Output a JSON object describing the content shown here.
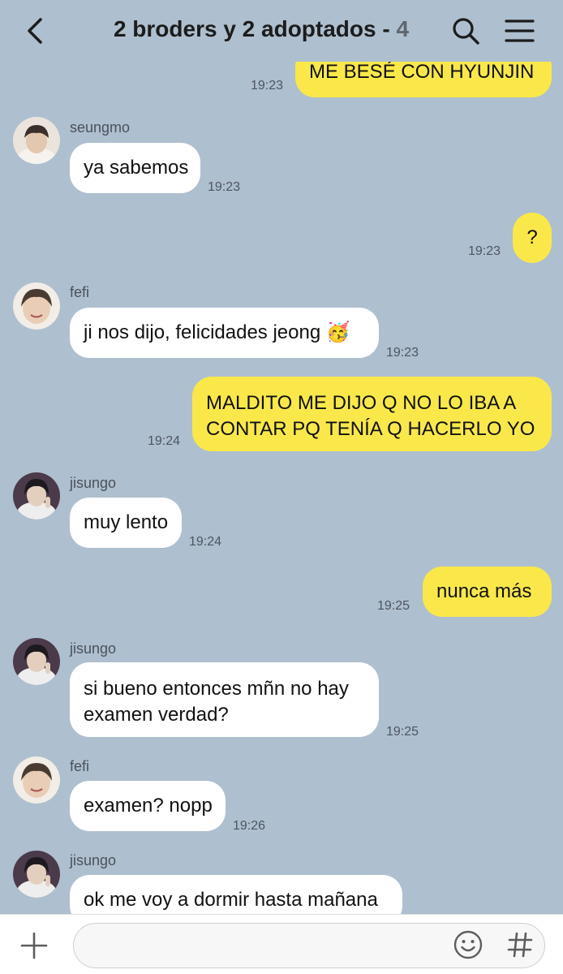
{
  "header": {
    "title": "2 broders y 2 adoptados",
    "member_count": "4",
    "dash": " - "
  },
  "messages": [
    {
      "side": "out",
      "text": "ME BESÉ CON HYUNJIN",
      "time": "19:23"
    },
    {
      "side": "in",
      "sender": "seungmo",
      "text": "ya sabemos",
      "time": "19:23"
    },
    {
      "side": "out",
      "text": "?",
      "time": "19:23"
    },
    {
      "side": "in",
      "sender": "fefi",
      "text": "ji nos dijo, felicidades jeong 🥳",
      "time": "19:23"
    },
    {
      "side": "out",
      "text_lines": [
        "MALDITO ME DIJO Q NO LO IBA A",
        "CONTAR PQ TENÍA Q HACERLO YO"
      ],
      "time": "19:24"
    },
    {
      "side": "in",
      "sender": "jisungo",
      "text": "muy lento",
      "time": "19:24"
    },
    {
      "side": "out",
      "text": "nunca más",
      "time": "19:25"
    },
    {
      "side": "in",
      "sender": "jisungo",
      "text_lines": [
        "si bueno entonces mñn no hay",
        "examen verdad?"
      ],
      "time": "19:25"
    },
    {
      "side": "in",
      "sender": "fefi",
      "text": "examen? nopp",
      "time": "19:26"
    },
    {
      "side": "in",
      "sender": "jisungo",
      "text": "ok me voy a dormir hasta mañana",
      "time": ""
    }
  ],
  "composer": {
    "value": "",
    "placeholder": ""
  },
  "icons": {
    "back": "chevron-left-icon",
    "search": "search-icon",
    "menu": "hamburger-menu-icon",
    "plus": "plus-icon",
    "emoji": "emoji-smile-icon",
    "hash": "hashtag-icon"
  },
  "colors": {
    "background": "#aebfcf",
    "outgoing_bubble": "#fae84a",
    "incoming_bubble": "#ffffff"
  }
}
